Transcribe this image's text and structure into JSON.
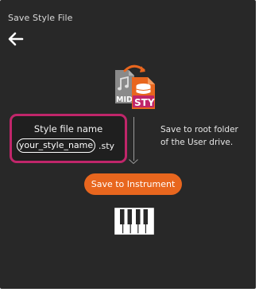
{
  "header": {
    "title": "Save Style File"
  },
  "file_icon": {
    "label_midi": "MID",
    "label_sty": "STY",
    "accent_color": "#e8661e"
  },
  "filename_box": {
    "label": "Style file name",
    "value": "your_style_name",
    "extension": ".sty",
    "highlight_color": "#c0266a"
  },
  "destination": {
    "line1": "Save to root folder",
    "line2": "of the User drive."
  },
  "actions": {
    "save_label": "Save to Instrument"
  },
  "icons": {
    "back": "arrow-left-icon",
    "file": "midi-to-sty-file-icon",
    "instrument": "piano-keyboard-icon"
  }
}
